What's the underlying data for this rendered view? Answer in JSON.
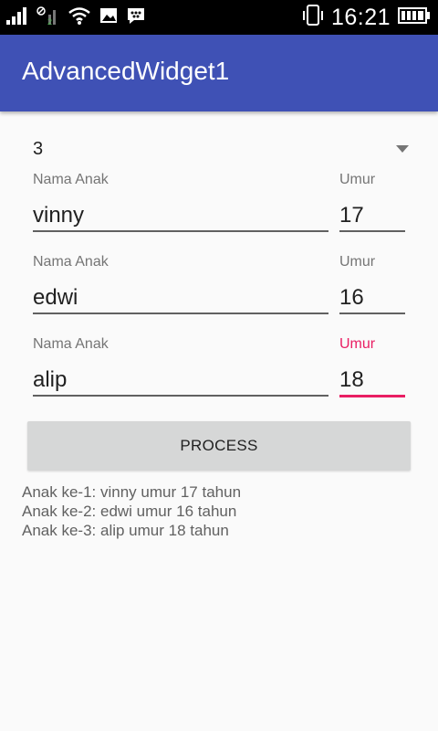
{
  "status_bar": {
    "time": "16:21",
    "icons": [
      "signal-icon",
      "signal-2-icon",
      "wifi-icon",
      "image-icon",
      "bbm-icon",
      "vibrate-icon",
      "battery-icon"
    ]
  },
  "app_bar": {
    "title": "AdvancedWidget1"
  },
  "spinner": {
    "selected": "3"
  },
  "children": [
    {
      "name_label": "Nama Anak",
      "name_value": "vinny",
      "age_label": "Umur",
      "age_value": "17"
    },
    {
      "name_label": "Nama Anak",
      "name_value": "edwi",
      "age_label": "Umur",
      "age_value": "16"
    },
    {
      "name_label": "Nama Anak",
      "name_value": "alip",
      "age_label": "Umur",
      "age_value": "18"
    }
  ],
  "process_button": {
    "label": "PROCESS"
  },
  "results": [
    "Anak ke-1: vinny umur 17 tahun",
    "Anak ke-2: edwi umur 16 tahun",
    "Anak ke-3: alip umur 18 tahun"
  ],
  "colors": {
    "primary": "#3f51b5",
    "accent": "#e91e63",
    "button": "#d6d7d7"
  }
}
